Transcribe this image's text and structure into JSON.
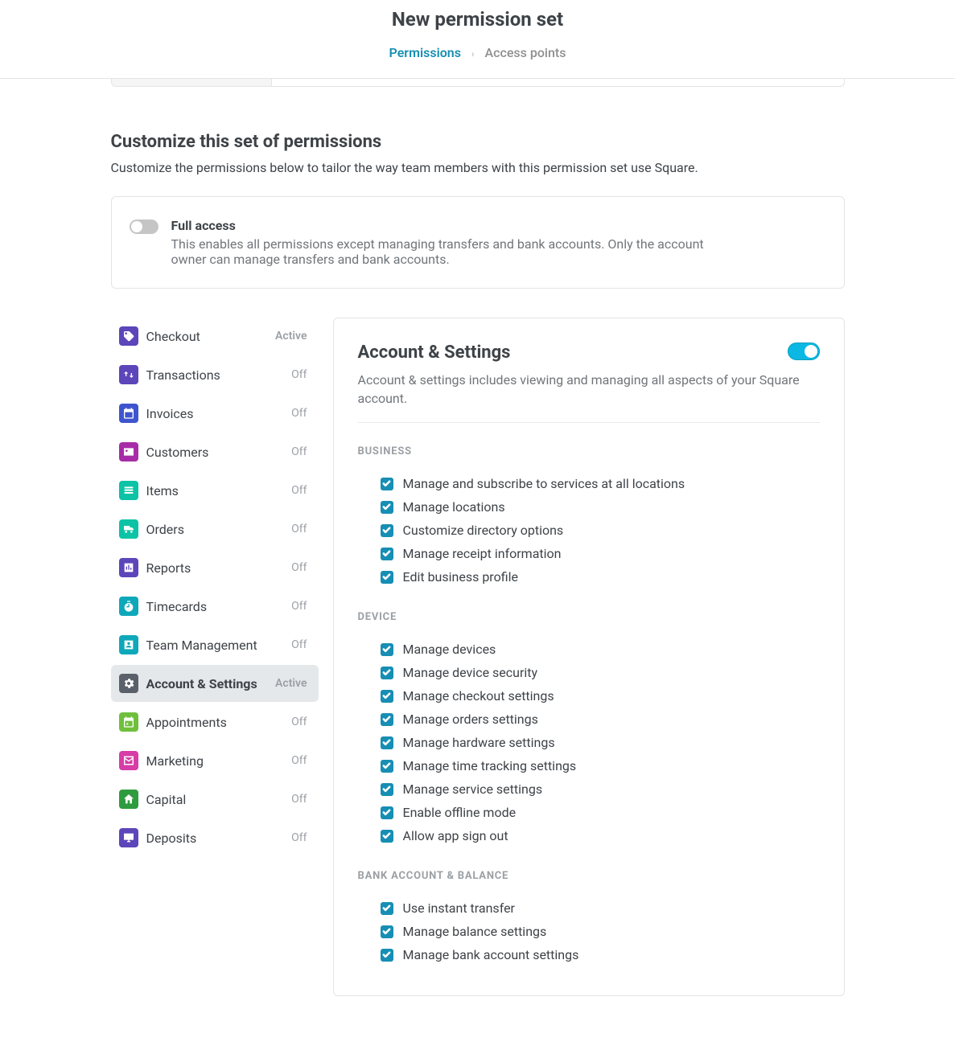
{
  "header": {
    "title": "New permission set",
    "crumbs": {
      "link": "Permissions",
      "current": "Access points"
    }
  },
  "section": {
    "title": "Customize this set of permissions",
    "desc": "Customize the permissions below to tailor the way team members with this permission set use Square."
  },
  "fullAccess": {
    "title": "Full access",
    "desc": "This enables all permissions except managing transfers and bank accounts. Only the account owner can manage transfers and bank accounts."
  },
  "sidebar": {
    "items": [
      {
        "label": "Checkout",
        "status": "Active",
        "icon": "tag",
        "color": "ico-purple",
        "active": false,
        "statusOn": true
      },
      {
        "label": "Transactions",
        "status": "Off",
        "icon": "swap",
        "color": "ico-purple",
        "active": false,
        "statusOn": false
      },
      {
        "label": "Invoices",
        "status": "Off",
        "icon": "calendar",
        "color": "ico-blue",
        "active": false,
        "statusOn": false
      },
      {
        "label": "Customers",
        "status": "Off",
        "icon": "usercard",
        "color": "ico-magenta",
        "active": false,
        "statusOn": false
      },
      {
        "label": "Items",
        "status": "Off",
        "icon": "list",
        "color": "ico-teal",
        "active": false,
        "statusOn": false
      },
      {
        "label": "Orders",
        "status": "Off",
        "icon": "truck",
        "color": "ico-teal",
        "active": false,
        "statusOn": false
      },
      {
        "label": "Reports",
        "status": "Off",
        "icon": "chart",
        "color": "ico-purple",
        "active": false,
        "statusOn": false
      },
      {
        "label": "Timecards",
        "status": "Off",
        "icon": "timer",
        "color": "ico-cyan",
        "active": false,
        "statusOn": false
      },
      {
        "label": "Team Management",
        "status": "Off",
        "icon": "person",
        "color": "ico-cyan",
        "active": false,
        "statusOn": false
      },
      {
        "label": "Account & Settings",
        "status": "Active",
        "icon": "gear",
        "color": "ico-slate",
        "active": true,
        "statusOn": true
      },
      {
        "label": "Appointments",
        "status": "Off",
        "icon": "date",
        "color": "ico-green",
        "active": false,
        "statusOn": false
      },
      {
        "label": "Marketing",
        "status": "Off",
        "icon": "mail",
        "color": "ico-pink",
        "active": false,
        "statusOn": false
      },
      {
        "label": "Capital",
        "status": "Off",
        "icon": "home",
        "color": "ico-darkgreen",
        "active": false,
        "statusOn": false
      },
      {
        "label": "Deposits",
        "status": "Off",
        "icon": "monitor",
        "color": "ico-purple",
        "active": false,
        "statusOn": false
      }
    ]
  },
  "detail": {
    "title": "Account & Settings",
    "desc": "Account & settings includes viewing and managing all aspects of your Square account.",
    "toggle": true,
    "groups": [
      {
        "title": "Business",
        "perms": [
          {
            "label": "Manage and subscribe to services at all locations",
            "checked": true
          },
          {
            "label": "Manage locations",
            "checked": true
          },
          {
            "label": "Customize directory options",
            "checked": true
          },
          {
            "label": "Manage receipt information",
            "checked": true
          },
          {
            "label": "Edit business profile",
            "checked": true
          }
        ]
      },
      {
        "title": "Device",
        "perms": [
          {
            "label": "Manage devices",
            "checked": true
          },
          {
            "label": "Manage device security",
            "checked": true
          },
          {
            "label": "Manage checkout settings",
            "checked": true
          },
          {
            "label": "Manage orders settings",
            "checked": true
          },
          {
            "label": "Manage hardware settings",
            "checked": true
          },
          {
            "label": "Manage time tracking settings",
            "checked": true
          },
          {
            "label": "Manage service settings",
            "checked": true
          },
          {
            "label": "Enable offline mode",
            "checked": true
          },
          {
            "label": "Allow app sign out",
            "checked": true
          }
        ]
      },
      {
        "title": "Bank Account & Balance",
        "perms": [
          {
            "label": "Use instant transfer",
            "checked": true
          },
          {
            "label": "Manage balance settings",
            "checked": true
          },
          {
            "label": "Manage bank account settings",
            "checked": true
          }
        ]
      }
    ]
  }
}
